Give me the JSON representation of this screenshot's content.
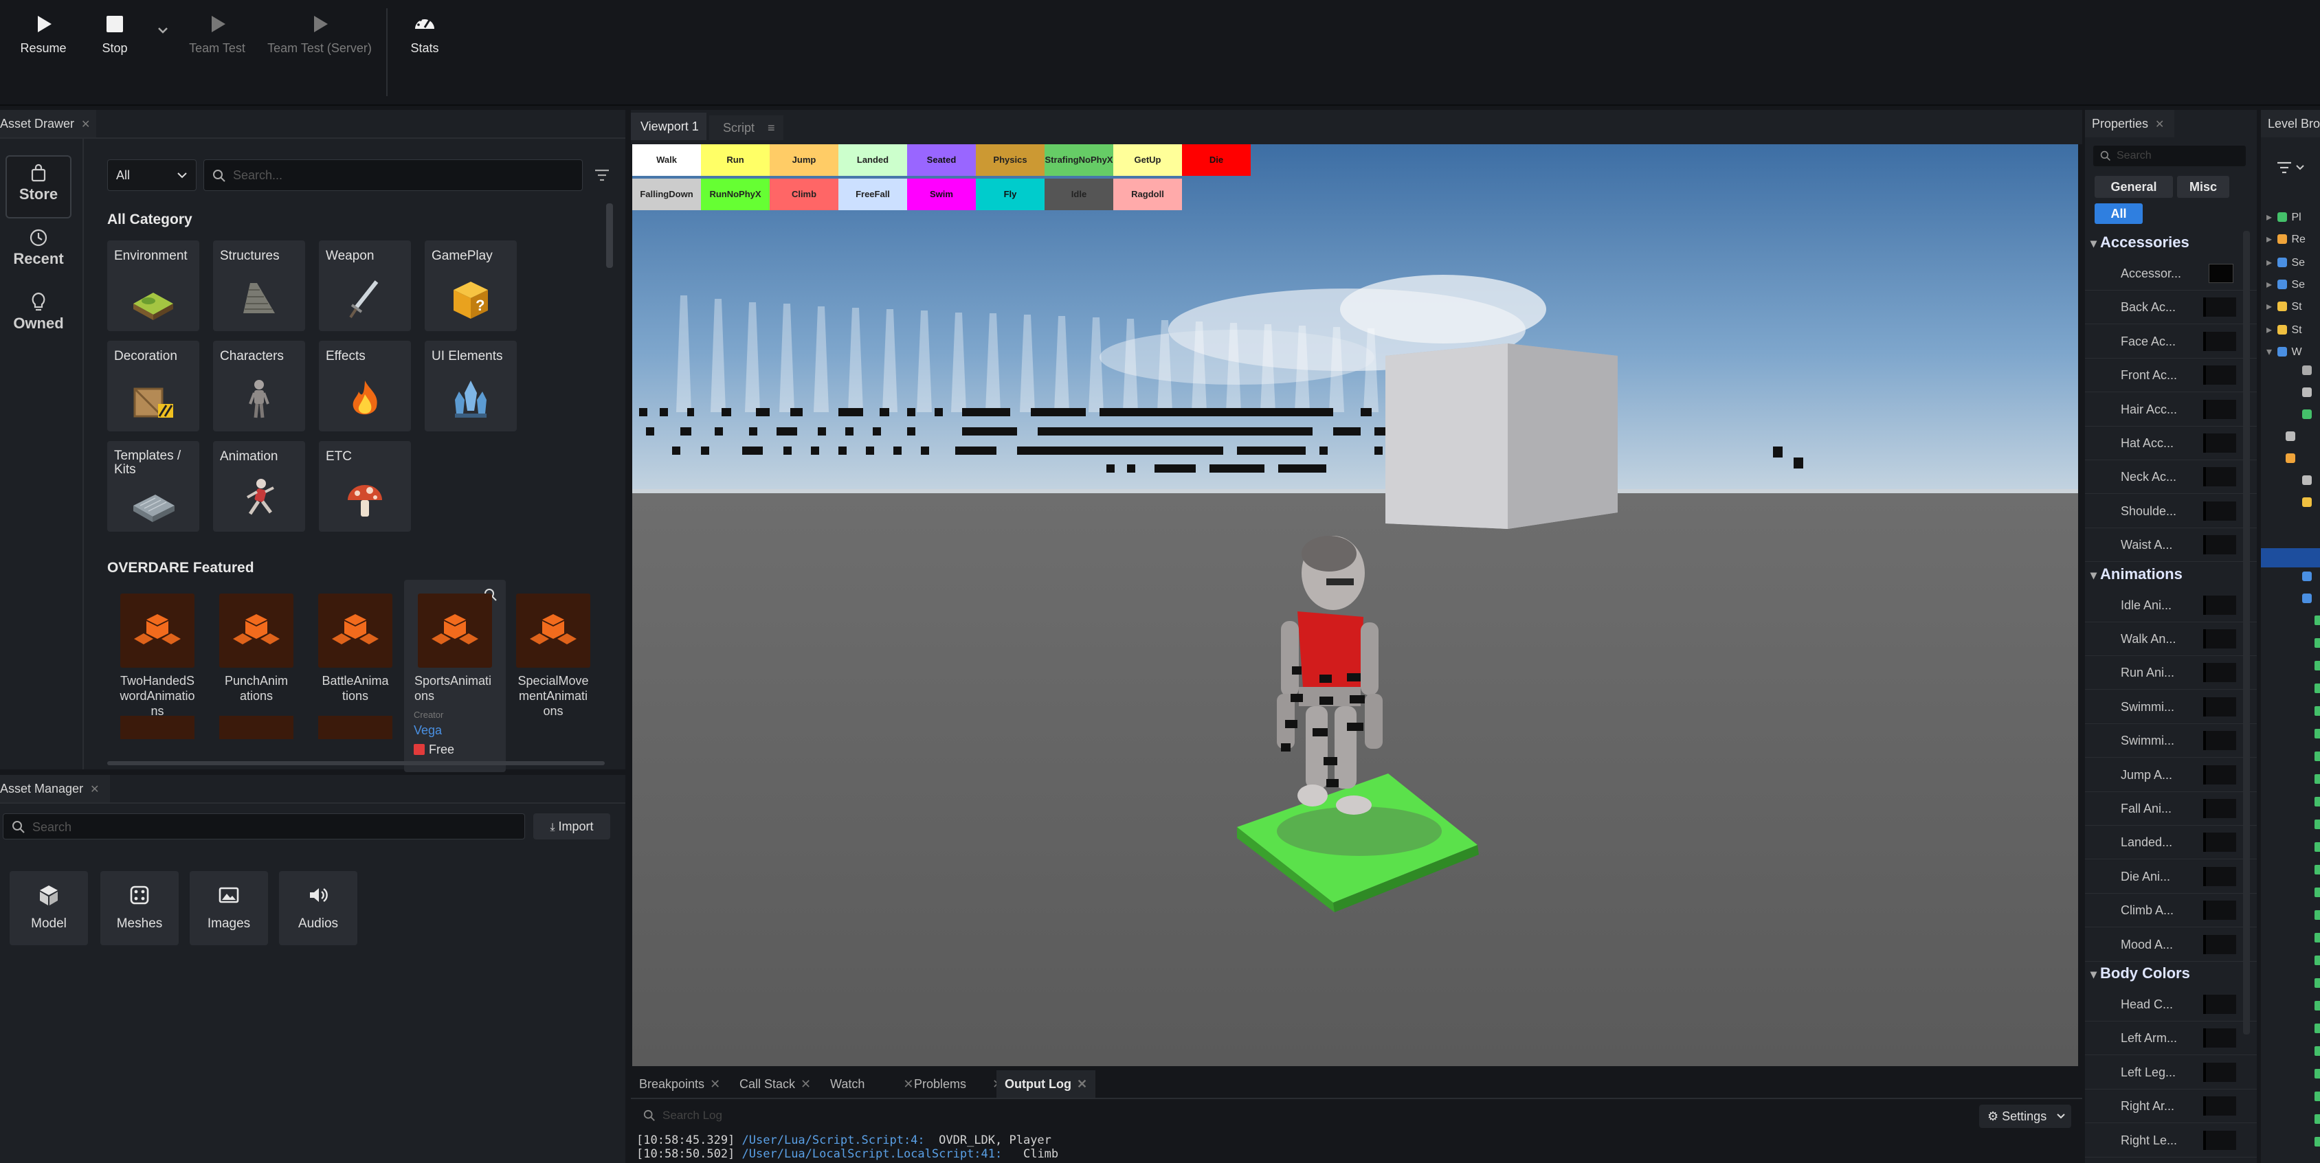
{
  "toolbar": {
    "resume": "Resume",
    "stop": "Stop",
    "team_test": "Team Test",
    "team_test_server": "Team Test (Server)",
    "stats": "Stats"
  },
  "asset_drawer": {
    "tab": "Asset Drawer",
    "side": {
      "store": "Store",
      "recent": "Recent",
      "owned": "Owned"
    },
    "filter": "All",
    "search_placeholder": "Search...",
    "category_title": "All Category",
    "categories": [
      "Environment",
      "Structures",
      "Weapon",
      "GamePlay",
      "Decoration",
      "Characters",
      "Effects",
      "UI Elements",
      "Templates / Kits",
      "Animation",
      "ETC"
    ],
    "featured_title": "OVERDARE Featured",
    "featured": [
      "TwoHandedSwordAnimations",
      "PunchAnimations",
      "BattleAnimations",
      "SportsAnimations",
      "SpecialMovementAnimations"
    ],
    "hover": {
      "creator_label": "Creator",
      "creator": "Vega",
      "price": "Free"
    }
  },
  "asset_manager": {
    "tab": "Asset Manager",
    "search_placeholder": "Search",
    "import": "Import",
    "cards": [
      "Model",
      "Meshes",
      "Images",
      "Audios"
    ]
  },
  "viewport": {
    "tab1": "Viewport 1",
    "tab2": "Script",
    "anim_buttons_row1": [
      {
        "label": "Walk",
        "color": "#ffffff"
      },
      {
        "label": "Run",
        "color": "#ffff66"
      },
      {
        "label": "Jump",
        "color": "#ffcc66"
      },
      {
        "label": "Landed",
        "color": "#ccffcc"
      },
      {
        "label": "Seated",
        "color": "#9966ff"
      },
      {
        "label": "Physics",
        "color": "#cc9933"
      },
      {
        "label": "StrafingNoPhyX",
        "color": "#66cc66"
      },
      {
        "label": "GetUp",
        "color": "#ffff99"
      },
      {
        "label": "Die",
        "color": "#ff0000"
      }
    ],
    "anim_buttons_row2": [
      {
        "label": "FallingDown",
        "color": "#cccccc"
      },
      {
        "label": "RunNoPhyX",
        "color": "#66ff33"
      },
      {
        "label": "Climb",
        "color": "#ff6666"
      },
      {
        "label": "FreeFall",
        "color": "#cce0ff"
      },
      {
        "label": "Swim",
        "color": "#ff00ff"
      },
      {
        "label": "Fly",
        "color": "#00cccc"
      },
      {
        "label": "Idle",
        "color": "#555555"
      },
      {
        "label": "Ragdoll",
        "color": "#ffaaaa"
      }
    ]
  },
  "bottom": {
    "tabs": [
      "Breakpoints",
      "Call Stack",
      "Watch",
      "Problems",
      "Output Log"
    ],
    "search_placeholder": "Search Log",
    "settings": "Settings",
    "logs": [
      {
        "time": "[10:58:45.329]",
        "path": "/User/Lua/Script.Script:4:",
        "msg": "OVDR_LDK, Player"
      },
      {
        "time": "[10:58:50.502]",
        "path": "/User/Lua/LocalScript.LocalScript:41:",
        "msg": "Climb"
      }
    ]
  },
  "properties": {
    "tab": "Properties",
    "search_placeholder": "Search",
    "tabs": [
      "General",
      "Misc"
    ],
    "filter": "All",
    "sections": [
      {
        "title": "Accessories",
        "items": [
          "Accessor...",
          "Back Ac...",
          "Face Ac...",
          "Front Ac...",
          "Hair Acc...",
          "Hat Acc...",
          "Neck Ac...",
          "Shoulde...",
          "Waist A..."
        ]
      },
      {
        "title": "Animations",
        "items": [
          "Idle Ani...",
          "Walk An...",
          "Run Ani...",
          "Swimmi...",
          "Swimmi...",
          "Jump A...",
          "Fall Ani...",
          "Landed...",
          "Die Ani...",
          "Climb A...",
          "Mood A..."
        ]
      },
      {
        "title": "Body Colors",
        "items": [
          "Head C...",
          "Left Arm...",
          "Left Leg...",
          "Right Ar...",
          "Right Le..."
        ]
      }
    ]
  },
  "level_browser": {
    "tab": "Level Bro",
    "items": [
      "Pl",
      "Re",
      "Se",
      "Se",
      "St",
      "St",
      "W"
    ]
  }
}
